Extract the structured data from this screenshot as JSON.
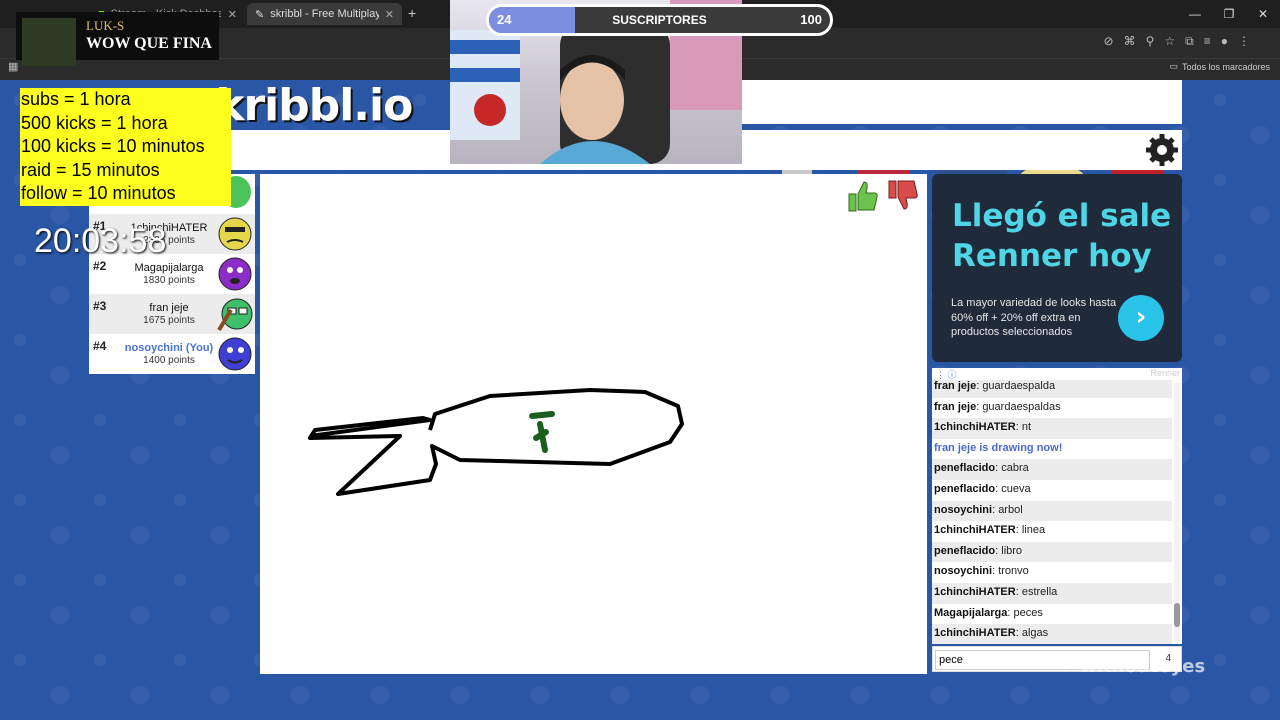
{
  "browser": {
    "tabs": [
      {
        "title": "Stream - Kick Dashboard",
        "active": false
      },
      {
        "title": "skribbl - Free Multiplayer Drawing",
        "active": true
      }
    ],
    "bookmarks_label": "Todos los marcadores"
  },
  "game": {
    "logo": "skribbl.io",
    "players": [
      {
        "rank": "#1",
        "name": "1chinchiHATER",
        "points": "2335 points",
        "avatar_color": "#e6d74a"
      },
      {
        "rank": "#2",
        "name": "Magapijalarga",
        "points": "1830 points",
        "avatar_color": "#8a2ec7"
      },
      {
        "rank": "#3",
        "name": "fran jeje",
        "points": "1675 points",
        "avatar_color": "#3fbf6a"
      },
      {
        "rank": "#4",
        "name": "nosoychini (You)",
        "points": "1400 points",
        "avatar_color": "#3f3fd6"
      }
    ],
    "chat": [
      {
        "user": "fran jeje",
        "text": "guardaespalda"
      },
      {
        "user": "fran jeje",
        "text": "guardaespaldas"
      },
      {
        "user": "1chinchiHATER",
        "text": "nt"
      },
      {
        "system": "fran jeje is drawing now!"
      },
      {
        "user": "peneflacido",
        "text": "cabra"
      },
      {
        "user": "peneflacido",
        "text": "cueva"
      },
      {
        "user": "nosoychini",
        "text": "arbol"
      },
      {
        "user": "1chinchiHATER",
        "text": "linea"
      },
      {
        "user": "peneflacido",
        "text": "libro"
      },
      {
        "user": "nosoychini",
        "text": "tronvo"
      },
      {
        "user": "1chinchiHATER",
        "text": "estrella"
      },
      {
        "user": "Magapijalarga",
        "text": "peces"
      },
      {
        "user": "1chinchiHATER",
        "text": "algas"
      }
    ],
    "chat_input": {
      "value": "pece",
      "count": "4"
    }
  },
  "ad": {
    "headline": "Llegó el sale Renner hoy",
    "body": "La mayor variedad de looks hasta 60% off + 20% off extra en productos seleccionados",
    "cta": "›",
    "brand": "Renner"
  },
  "overlay": {
    "alert_user": "LUK-S",
    "alert_message": "WOW QUE FINA",
    "rules": [
      "subs = 1 hora",
      "500 kicks = 1 hora",
      "100 kicks = 10 minutos",
      "raid = 15 minutos",
      "follow = 10 minutos"
    ],
    "timer": "20:03:58",
    "sub_goal": {
      "current": "24",
      "label": "SUSCRIPTORES",
      "goal": "100",
      "progress": 0.24
    },
    "watermark": "with0uteyes"
  }
}
